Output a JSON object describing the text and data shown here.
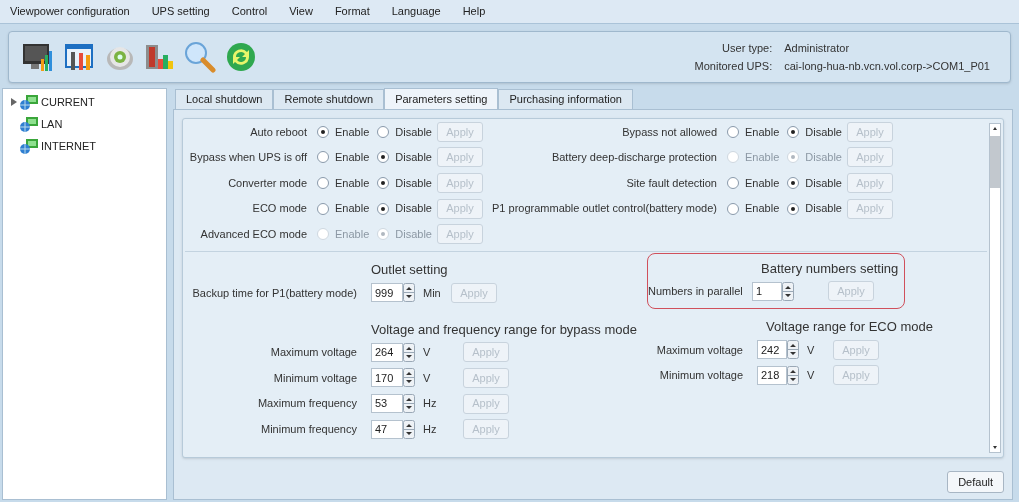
{
  "menu": [
    "Viewpower configuration",
    "UPS setting",
    "Control",
    "View",
    "Format",
    "Language",
    "Help"
  ],
  "header": {
    "rows": [
      {
        "label": "User type:",
        "value": "Administrator"
      },
      {
        "label": "Monitored UPS:",
        "value": "cai-long-hua-nb.vcn.vol.corp->COM1_P01"
      }
    ]
  },
  "sidebar": {
    "items": [
      {
        "label": "CURRENT",
        "expanded": false
      },
      {
        "label": "LAN"
      },
      {
        "label": "INTERNET"
      }
    ]
  },
  "tabs": [
    {
      "label": "Local shutdown",
      "selected": false
    },
    {
      "label": "Remote shutdown",
      "selected": false
    },
    {
      "label": "Parameters setting",
      "selected": true
    },
    {
      "label": "Purchasing information",
      "selected": false
    }
  ],
  "options_left": [
    {
      "label": "Auto reboot",
      "disabled": false,
      "radios": [
        {
          "label": "Enable",
          "selected": true
        },
        {
          "label": "Disable",
          "selected": false
        }
      ],
      "apply": "Apply"
    },
    {
      "label": "Bypass when UPS is off",
      "disabled": false,
      "radios": [
        {
          "label": "Enable",
          "selected": false
        },
        {
          "label": "Disable",
          "selected": true
        }
      ],
      "apply": "Apply"
    },
    {
      "label": "Converter mode",
      "disabled": false,
      "radios": [
        {
          "label": "Enable",
          "selected": false
        },
        {
          "label": "Disable",
          "selected": true
        }
      ],
      "apply": "Apply"
    },
    {
      "label": "ECO mode",
      "disabled": false,
      "radios": [
        {
          "label": "Enable",
          "selected": false
        },
        {
          "label": "Disable",
          "selected": true
        }
      ],
      "apply": "Apply"
    },
    {
      "label": "Advanced ECO mode",
      "disabled": true,
      "radios": [
        {
          "label": "Enable",
          "selected": false
        },
        {
          "label": "Disable",
          "selected": true
        }
      ],
      "apply": "Apply"
    }
  ],
  "options_right": [
    {
      "label": "Bypass not allowed",
      "disabled": false,
      "radios": [
        {
          "label": "Enable",
          "selected": false
        },
        {
          "label": "Disable",
          "selected": true
        }
      ],
      "apply": "Apply"
    },
    {
      "label": "Battery deep-discharge protection",
      "disabled": true,
      "radios": [
        {
          "label": "Enable",
          "selected": false
        },
        {
          "label": "Disable",
          "selected": true
        }
      ],
      "apply": "Apply"
    },
    {
      "label": "Site fault detection",
      "disabled": false,
      "radios": [
        {
          "label": "Enable",
          "selected": false
        },
        {
          "label": "Disable",
          "selected": true
        }
      ],
      "apply": "Apply"
    },
    {
      "label": "P1 programmable outlet control(battery mode)",
      "disabled": false,
      "radios": [
        {
          "label": "Enable",
          "selected": false
        },
        {
          "label": "Disable",
          "selected": true
        }
      ],
      "apply": "Apply"
    }
  ],
  "outlet": {
    "title": "Outlet setting",
    "rows": [
      {
        "label": "Backup time for P1(battery mode)",
        "value": "999",
        "unit": "Min",
        "apply": "Apply"
      }
    ]
  },
  "battery": {
    "title": "Battery numbers setting",
    "highlighted": true,
    "rows": [
      {
        "label": "Numbers in parallel",
        "value": "1",
        "apply": "Apply"
      }
    ]
  },
  "bypass_range": {
    "title": "Voltage and frequency range for bypass mode",
    "rows": [
      {
        "label": "Maximum voltage",
        "value": "264",
        "unit": "V",
        "apply": "Apply"
      },
      {
        "label": "Minimum voltage",
        "value": "170",
        "unit": "V",
        "apply": "Apply"
      },
      {
        "label": "Maximum frequency",
        "value": "53",
        "unit": "Hz",
        "apply": "Apply"
      },
      {
        "label": "Minimum frequency",
        "value": "47",
        "unit": "Hz",
        "apply": "Apply"
      }
    ]
  },
  "eco_range": {
    "title": "Voltage range for ECO mode",
    "rows": [
      {
        "label": "Maximum voltage",
        "value": "242",
        "unit": "V",
        "apply": "Apply"
      },
      {
        "label": "Minimum voltage",
        "value": "218",
        "unit": "V",
        "apply": "Apply"
      }
    ]
  },
  "footer": {
    "button": "Default"
  }
}
